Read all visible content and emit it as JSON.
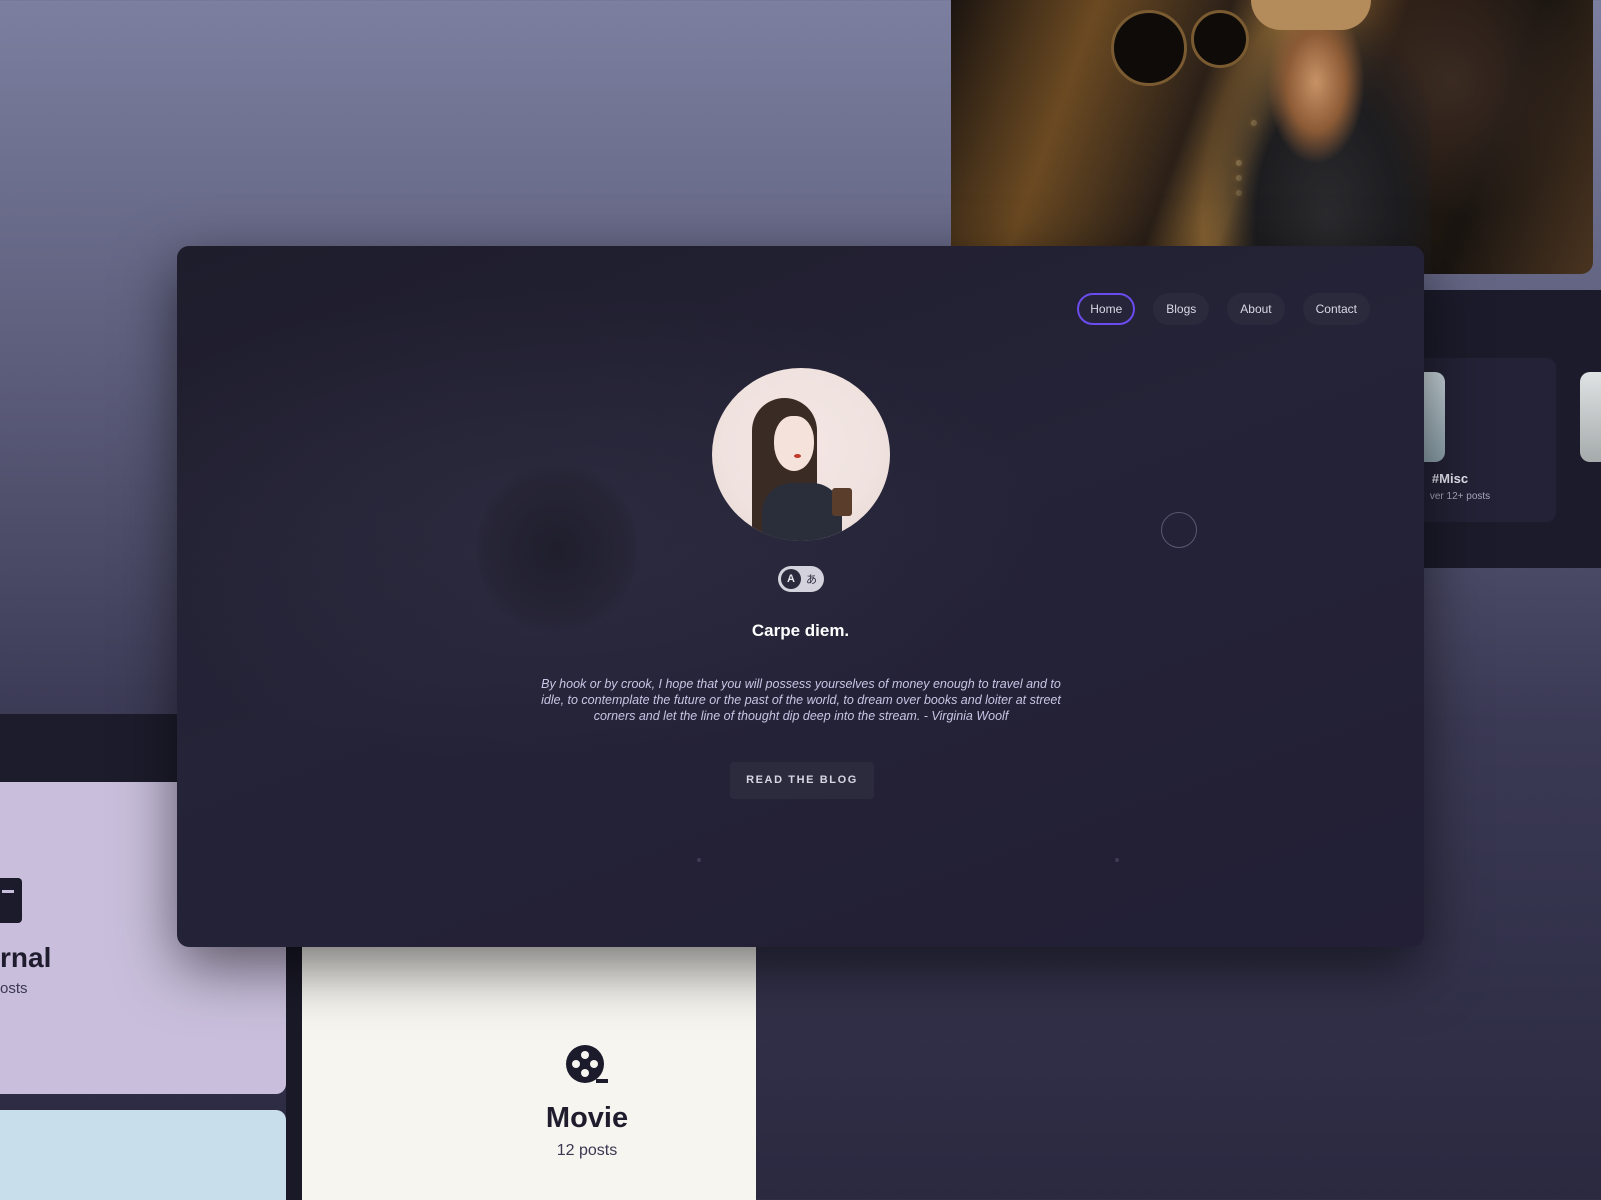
{
  "nav": {
    "items": [
      {
        "label": "Home",
        "active": true
      },
      {
        "label": "Blogs",
        "active": false
      },
      {
        "label": "About",
        "active": false
      },
      {
        "label": "Contact",
        "active": false
      }
    ]
  },
  "hero": {
    "lang_toggle": {
      "latin": "A",
      "kana": "あ"
    },
    "motto": "Carpe diem.",
    "quote": "By hook or by crook, I hope that you will possess yourselves of money enough to travel and to idle, to contemplate the future or the past of the world, to dream over books and loiter at street corners and let the line of thought dip deep into the stream. - Virginia Woolf",
    "cta_label": "READ THE BLOG"
  },
  "categories": [
    {
      "title": "#Misc",
      "count": "ver 12+ posts"
    },
    {
      "title": "rnal",
      "count": "osts"
    },
    {
      "title": "Movie",
      "count": "12 posts"
    }
  ],
  "colors": {
    "accent": "#6c4cf0",
    "hero_bg": "#221f36",
    "journal_card": "#c9bfdc",
    "movie_card": "#f7f5f0"
  }
}
